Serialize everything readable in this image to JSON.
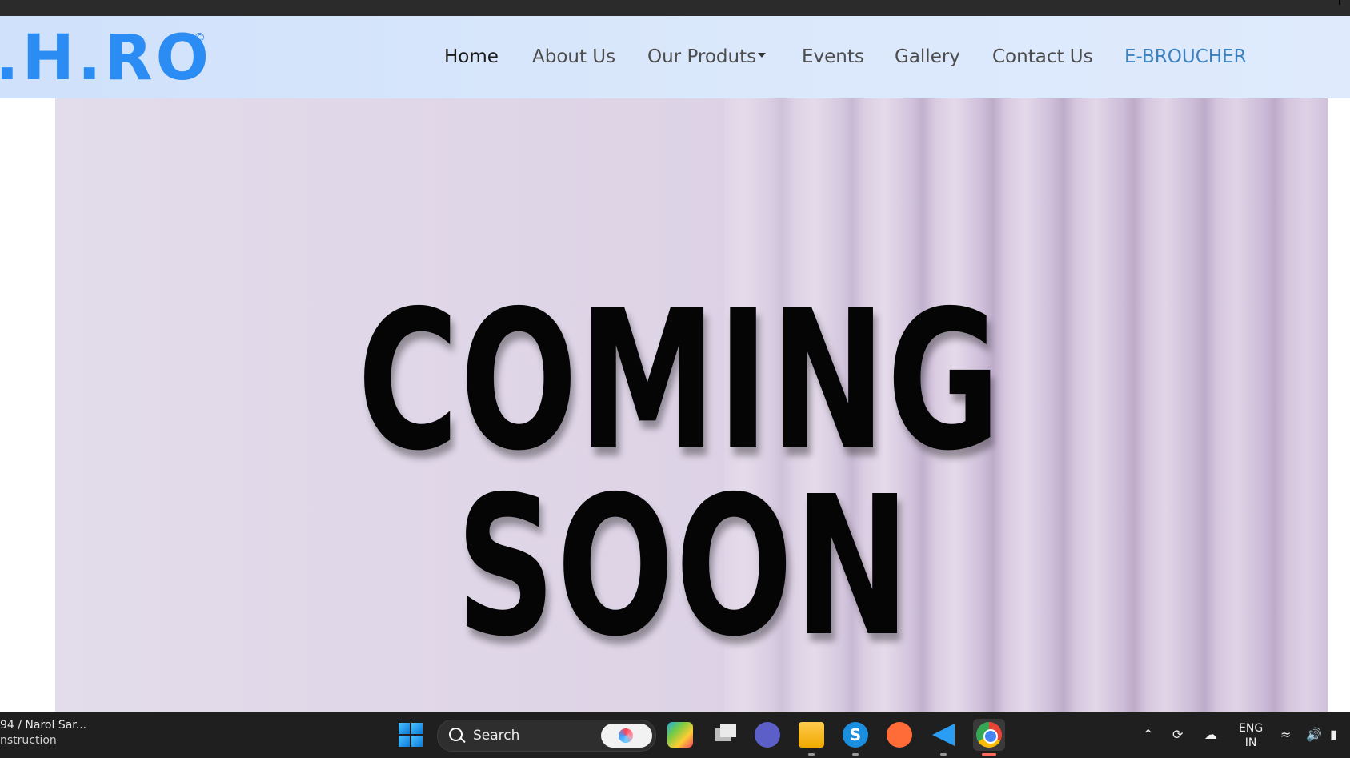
{
  "nav": {
    "logo_text": ".H.RO",
    "logo_reg": "©",
    "links": [
      {
        "label": "Home"
      },
      {
        "label": "About Us"
      },
      {
        "label": "Our Produts"
      },
      {
        "label": "Events"
      },
      {
        "label": "Gallery"
      },
      {
        "label": "Contact Us"
      },
      {
        "label": "E-BROUCHER"
      }
    ]
  },
  "hero": {
    "line1": "COMING",
    "line2": "SOON"
  },
  "taskbar": {
    "window_title": "94 / Narol Sar...",
    "window_subtitle": "nstruction",
    "search_label": "Search",
    "lang_top": "ENG",
    "lang_bottom": "IN",
    "icons": [
      "windows-start-icon",
      "search-icon",
      "copilot-icon",
      "copilot-pre-icon",
      "task-view-icon",
      "teams-icon",
      "file-explorer-icon",
      "skype-icon",
      "postman-icon",
      "vscode-icon",
      "chrome-icon"
    ]
  },
  "colors": {
    "accent": "#2b8cf3",
    "cta": "#3c82c0",
    "navbar": "#d7e6fb",
    "hero_bg": "#e3dcea"
  }
}
